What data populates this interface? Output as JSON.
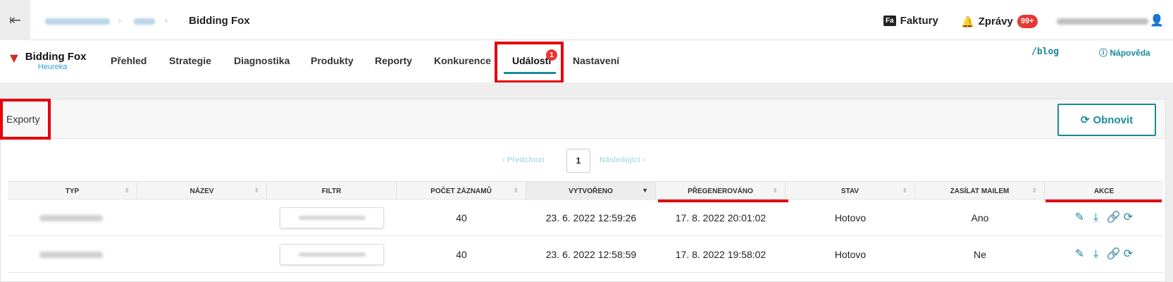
{
  "topbar": {
    "menu_icon": "menu-collapse-icon",
    "breadcrumb_current": "Bidding Fox",
    "invoices_label": "Faktury",
    "invoices_icon_text": "Fa",
    "messages_label": "Zprávy",
    "messages_count": "99+"
  },
  "nav": {
    "brand_name": "Bidding Fox",
    "brand_sub": "Heureka",
    "items": [
      "Přehled",
      "Strategie",
      "Diagnostika",
      "Produkty",
      "Reporty",
      "Konkurence",
      "Události",
      "Nastavení"
    ],
    "active": "Události",
    "active_badge": "1",
    "blog_label": "/blog",
    "help_label": "Nápověda"
  },
  "panel": {
    "title": "Exporty",
    "refresh_label": "Obnovit"
  },
  "pager": {
    "prev_label": "‹ Předchozí",
    "current_page": "1",
    "next_label": "Následující ›"
  },
  "table": {
    "columns": [
      "TYP",
      "NÁZEV",
      "FILTR",
      "POČET ZÁZNAMŮ",
      "VYTVOŘENO",
      "PŘEGENEROVÁNO",
      "STAV",
      "ZASÍLAT MAILEM",
      "AKCE"
    ],
    "rows": [
      {
        "count": "40",
        "created": "23. 6. 2022 12:59:26",
        "regenerated": "17. 8. 2022 20:01:02",
        "status": "Hotovo",
        "email": "Ano"
      },
      {
        "count": "40",
        "created": "23. 6. 2022 12:58:59",
        "regenerated": "17. 8. 2022 19:58:02",
        "status": "Hotovo",
        "email": "Ne"
      }
    ]
  },
  "colors": {
    "accent": "#1b8a9c",
    "highlight": "#e3000f",
    "badge": "#e53935"
  }
}
